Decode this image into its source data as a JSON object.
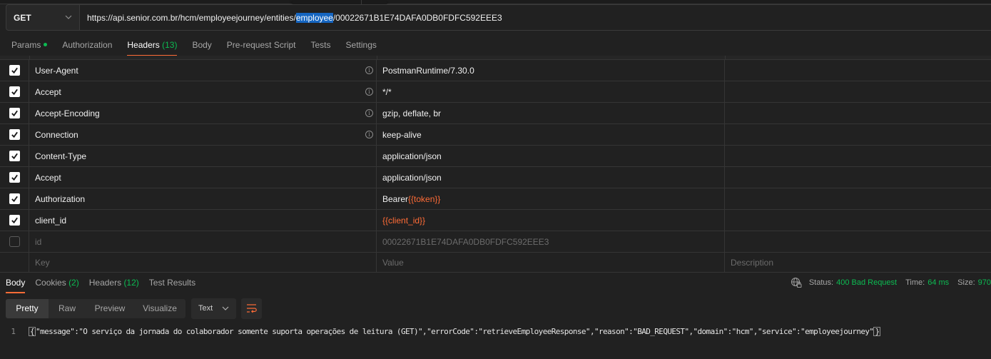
{
  "request": {
    "method": "GET",
    "url_prefix": "https://api.senior.com.br/hcm/employeejourney/entities/",
    "url_selected": "employee",
    "url_suffix": "/00022671B1E74DAFA0DB0FDFC592EEE3"
  },
  "request_tabs": [
    {
      "label": "Params",
      "count": "",
      "dot": true,
      "active": false
    },
    {
      "label": "Authorization",
      "count": "",
      "active": false
    },
    {
      "label": "Headers",
      "count": "(13)",
      "active": true
    },
    {
      "label": "Body",
      "count": "",
      "active": false
    },
    {
      "label": "Pre-request Script",
      "count": "",
      "active": false
    },
    {
      "label": "Tests",
      "count": "",
      "active": false
    },
    {
      "label": "Settings",
      "count": "",
      "active": false
    }
  ],
  "headers": {
    "rows": [
      {
        "key": "User-Agent",
        "value": "PostmanRuntime/7.30.0",
        "checked": true,
        "info": true
      },
      {
        "key": "Accept",
        "value": "*/*",
        "checked": true,
        "info": true
      },
      {
        "key": "Accept-Encoding",
        "value": "gzip, deflate, br",
        "checked": true,
        "info": true
      },
      {
        "key": "Connection",
        "value": "keep-alive",
        "checked": true,
        "info": true
      },
      {
        "key": "Content-Type",
        "value": "application/json",
        "checked": true,
        "info": false
      },
      {
        "key": "Accept",
        "value": "application/json",
        "checked": true,
        "info": false
      },
      {
        "key": "Authorization",
        "value_prefix": "Bearer ",
        "value_var": "{{token}}",
        "checked": true,
        "info": false
      },
      {
        "key": "client_id",
        "value_var": "{{client_id}}",
        "checked": true,
        "info": false
      },
      {
        "key": "id",
        "value": "00022671B1E74DAFA0DB0FDFC592EEE3",
        "checked": false,
        "info": false
      }
    ],
    "placeholder": {
      "key": "Key",
      "value": "Value",
      "description": "Description"
    }
  },
  "response_tabs": [
    {
      "label": "Body",
      "count": "",
      "active": true
    },
    {
      "label": "Cookies",
      "count": "(2)",
      "active": false
    },
    {
      "label": "Headers",
      "count": "(12)",
      "active": false
    },
    {
      "label": "Test Results",
      "count": "",
      "active": false
    }
  ],
  "status_bar": {
    "status_label": "Status:",
    "status_value": "400 Bad Request",
    "time_label": "Time:",
    "time_value": "64 ms",
    "size_label": "Size:",
    "size_value": "970"
  },
  "view_modes": [
    "Pretty",
    "Raw",
    "Preview",
    "Visualize"
  ],
  "format": "Text",
  "response_body": {
    "line_number": "1",
    "open_brace": "{",
    "content": "\"message\":\"O serviço da jornada do colaborador somente suporta operações de leitura (GET)\",\"errorCode\":\"retrieveEmployeeResponse\",\"reason\":\"BAD_REQUEST\",\"domain\":\"hcm\",\"service\":\"employeejourney\"",
    "close_brace": "}"
  }
}
